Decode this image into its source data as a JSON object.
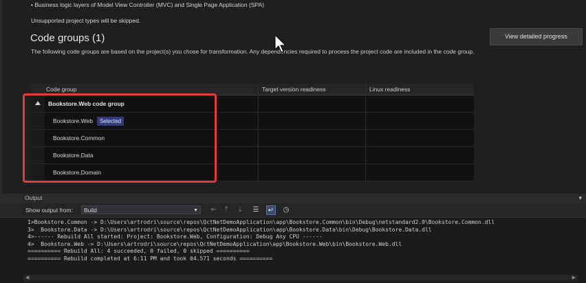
{
  "intro": {
    "bullet": "• Business logic layers of Model View Controller (MVC) and Single Page Application (SPA)",
    "unsupported": "Unsupported project types will be skipped."
  },
  "code_groups": {
    "heading": "Code groups (1)",
    "description": "The following code groups are based on the project(s) you chose for transformation. Any dependencies required to process the project code are included in the code group.",
    "view_button": "View detailed progress",
    "columns": [
      "Code group",
      "Target version readiness",
      "Linux readiness"
    ],
    "group_name": "Bookstore.Web code group",
    "rows": [
      {
        "name": "Bookstore.Web",
        "badge": "Selected"
      },
      {
        "name": "Bookstore.Common"
      },
      {
        "name": "Bookstore.Data"
      },
      {
        "name": "Bookstore.Domain"
      }
    ]
  },
  "output": {
    "title": "Output",
    "show_from_label": "Show output from:",
    "source": "Build",
    "lines": [
      "1>Bookstore.Common -> D:\\Users\\artrodri\\source\\repos\\QctNetDemoApplication\\app\\Bookstore.Common\\bin\\Debug\\netstandard2.0\\Bookstore.Common.dll",
      "3>  Bookstore.Data -> D:\\Users\\artrodri\\source\\repos\\QctNetDemoApplication\\app\\Bookstore.Data\\bin\\Debug\\Bookstore.Data.dll",
      "4>------ Rebuild All started: Project: Bookstore.Web, Configuration: Debug Any CPU ------",
      "4>  Bookstore.Web -> D:\\Users\\artrodri\\source\\repos\\QctNetDemoApplication\\app\\Bookstore.Web\\bin\\Bookstore.Web.dll",
      "========== Rebuild All: 4 succeeded, 0 failed, 0 skipped ==========",
      "========== Rebuild completed at 6:11 PM and took 04.571 seconds =========="
    ]
  },
  "colors": {
    "highlight_border": "#e23c3c",
    "badge_bg": "#343a7a"
  }
}
